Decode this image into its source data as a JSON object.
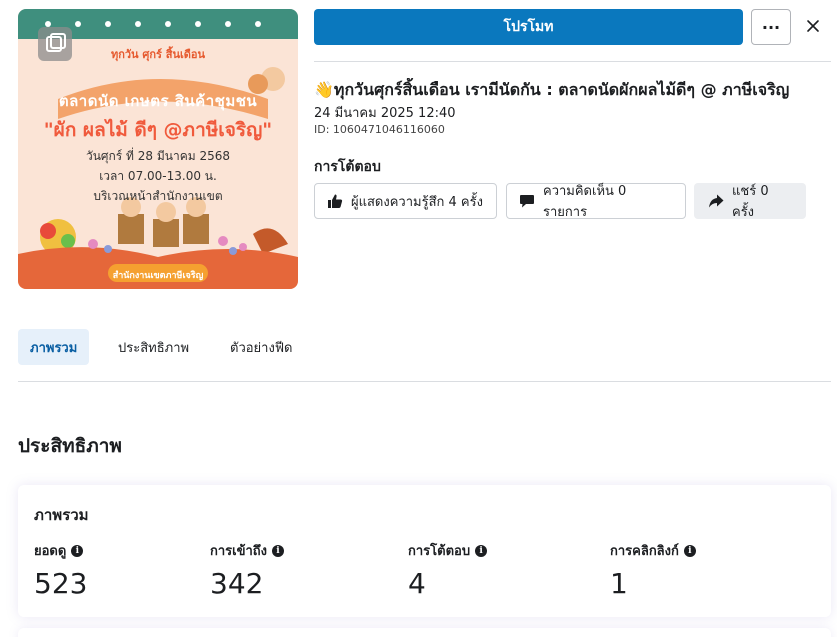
{
  "thumbnail": {
    "top_text": "ทุกวัน ศุกร์ สิ้นเดือน",
    "market_text": "ตลาดนัด เกษตร สินค้าชุมชน",
    "headline": "\"ผัก ผลไม้ ดีๆ @ภาษีเจริญ\"",
    "date_line": "วันศุกร์ ที่ 28 มีนาคม 2568",
    "time_line": "เวลา 07.00-13.00 น.",
    "place_line": "บริเวณหน้าสำนักงานเขต",
    "office_line": "สำนักงานเขตภาษีเจริญ"
  },
  "actions": {
    "promote_label": "โปรโมท",
    "more_label": "···"
  },
  "post": {
    "title": "👋ทุกวันศุกร์สิ้นเดือน เรามีนัดกัน : ตลาดนัดผักผลไม้ดีๆ @ ภาษีเจริญ",
    "date": "24 มีนาคม 2025 12:40",
    "id": "ID: 1060471046116060"
  },
  "engagement": {
    "title": "การโต้ตอบ",
    "likes": "ผู้แสดงความรู้สึก 4 ครั้ง",
    "comments": "ความคิดเห็น 0 รายการ",
    "shares": "แชร์ 0 ครั้ง"
  },
  "tabs": [
    "ภาพรวม",
    "ประสิทธิภาพ",
    "ตัวอย่างฟีด"
  ],
  "performance": {
    "title": "ประสิทธิภาพ",
    "card_title": "ภาพรวม",
    "metrics": [
      {
        "label": "ยอดดู",
        "value": "523"
      },
      {
        "label": "การเข้าถึง",
        "value": "342"
      },
      {
        "label": "การโต้ตอบ",
        "value": "4"
      },
      {
        "label": "การคลิกลิงก์",
        "value": "1"
      }
    ]
  },
  "colors": {
    "primary": "#0a78be",
    "tab_active_bg": "#e6f0fa",
    "thumb_bg": "#fbe4d6"
  }
}
